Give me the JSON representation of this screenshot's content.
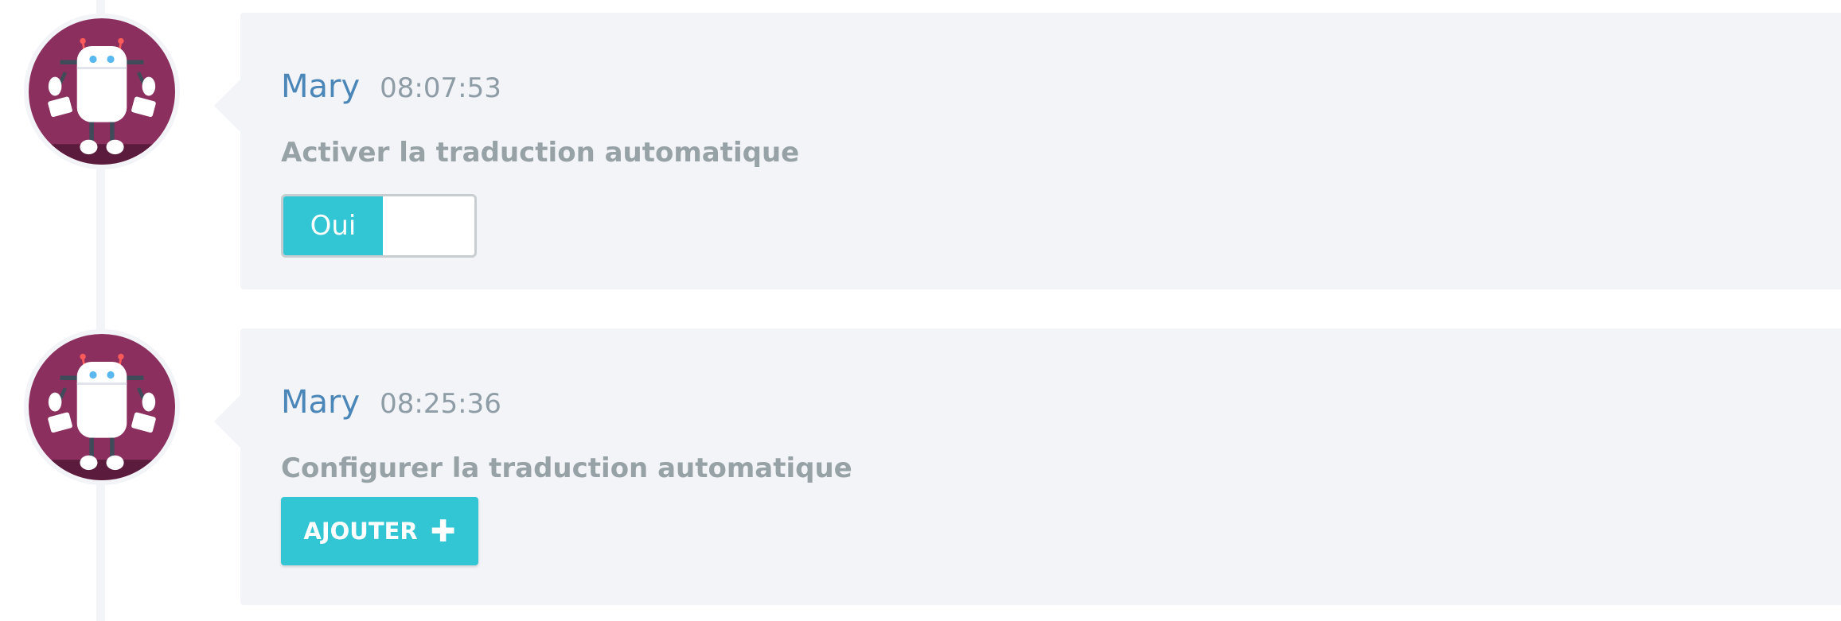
{
  "colors": {
    "author": "#4a86b8",
    "timestamp": "#8e9ca5",
    "question": "#97a2a7",
    "accent": "#32c6d4",
    "card_background": "#f3f4f8",
    "avatar_background": "#8b2f5e"
  },
  "messages": [
    {
      "author": "Mary",
      "time": "08:07:53",
      "question": "Activer la traduction automatique",
      "avatar_icon": "robot-avatar-icon",
      "toggle": {
        "on_label": "Oui",
        "state": "on"
      }
    },
    {
      "author": "Mary",
      "time": "08:25:36",
      "question": "Configurer la traduction automatique",
      "avatar_icon": "robot-avatar-icon",
      "button": {
        "label": "AJOUTER",
        "icon": "plus-icon"
      }
    }
  ]
}
